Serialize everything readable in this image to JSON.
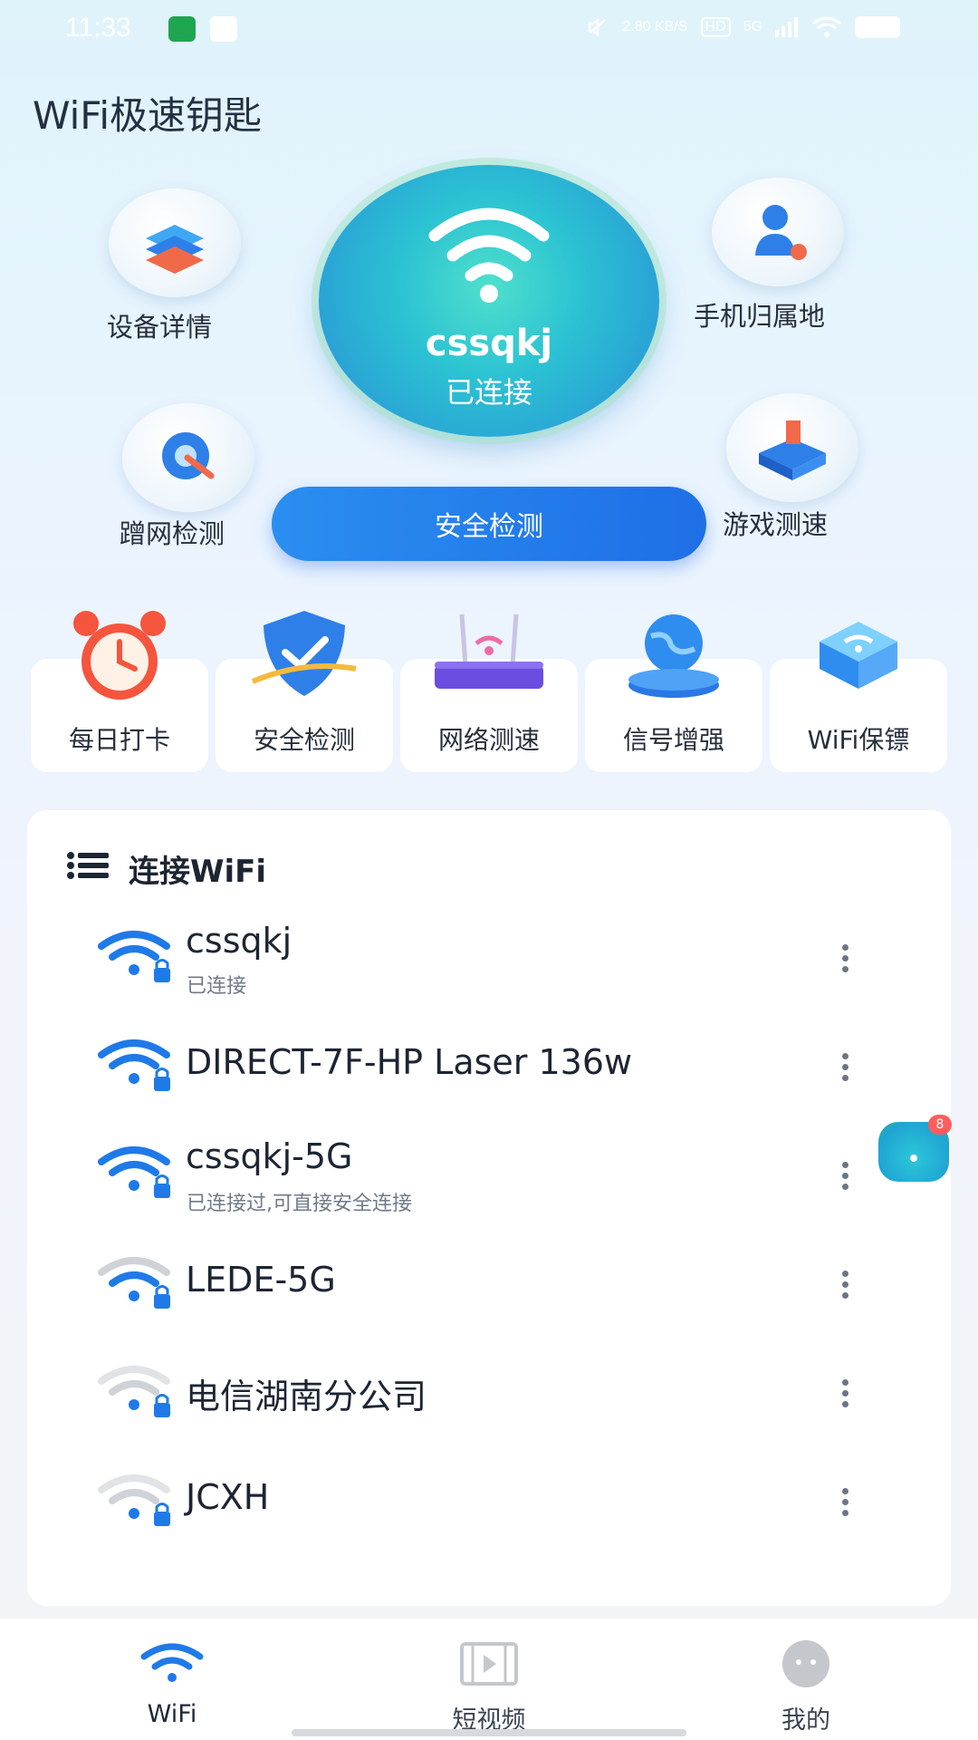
{
  "status_bar": {
    "time": "11:33",
    "net_speed": "2.80 KB/S",
    "hd": "HD",
    "network": "5G"
  },
  "app": {
    "title": "WiFi极速钥匙"
  },
  "connection": {
    "ssid": "cssqkj",
    "status": "已连接"
  },
  "features": {
    "device_detail": "设备详情",
    "phone_location": "手机归属地",
    "freeloader_check": "蹭网检测",
    "game_speed": "游戏测速",
    "safety_check_button": "安全检测"
  },
  "tools": [
    {
      "label": "每日打卡",
      "icon": "alarm-clock-icon"
    },
    {
      "label": "安全检测",
      "icon": "shield-check-icon"
    },
    {
      "label": "网络测速",
      "icon": "router-icon"
    },
    {
      "label": "信号增强",
      "icon": "globe-signal-icon"
    },
    {
      "label": "WiFi保镖",
      "icon": "wifi-guard-icon"
    }
  ],
  "wifi_list": {
    "title": "连接WiFi",
    "networks": [
      {
        "ssid": "cssqkj",
        "subtitle": "已连接",
        "signal": "strong",
        "locked": true
      },
      {
        "ssid": "DIRECT-7F-HP Laser 136w",
        "subtitle": "",
        "signal": "strong",
        "locked": true
      },
      {
        "ssid": "cssqkj-5G",
        "subtitle": "已连接过,可直接安全连接",
        "signal": "strong",
        "locked": true
      },
      {
        "ssid": "LEDE-5G",
        "subtitle": "",
        "signal": "weak",
        "locked": true
      },
      {
        "ssid": "电信湖南分公司",
        "subtitle": "",
        "signal": "weak",
        "locked": true
      },
      {
        "ssid": "JCXH",
        "subtitle": "",
        "signal": "weak",
        "locked": true
      }
    ]
  },
  "floating": {
    "badge": "8"
  },
  "bottom_nav": [
    {
      "label": "WiFi",
      "active": true
    },
    {
      "label": "短视频",
      "active": false
    },
    {
      "label": "我的",
      "active": false
    }
  ],
  "colors": {
    "accent": "#1f7ae8",
    "active_wifi": "#1f7ae8",
    "weak_wifi": "#c4c7cc",
    "text": "#1d2533"
  }
}
